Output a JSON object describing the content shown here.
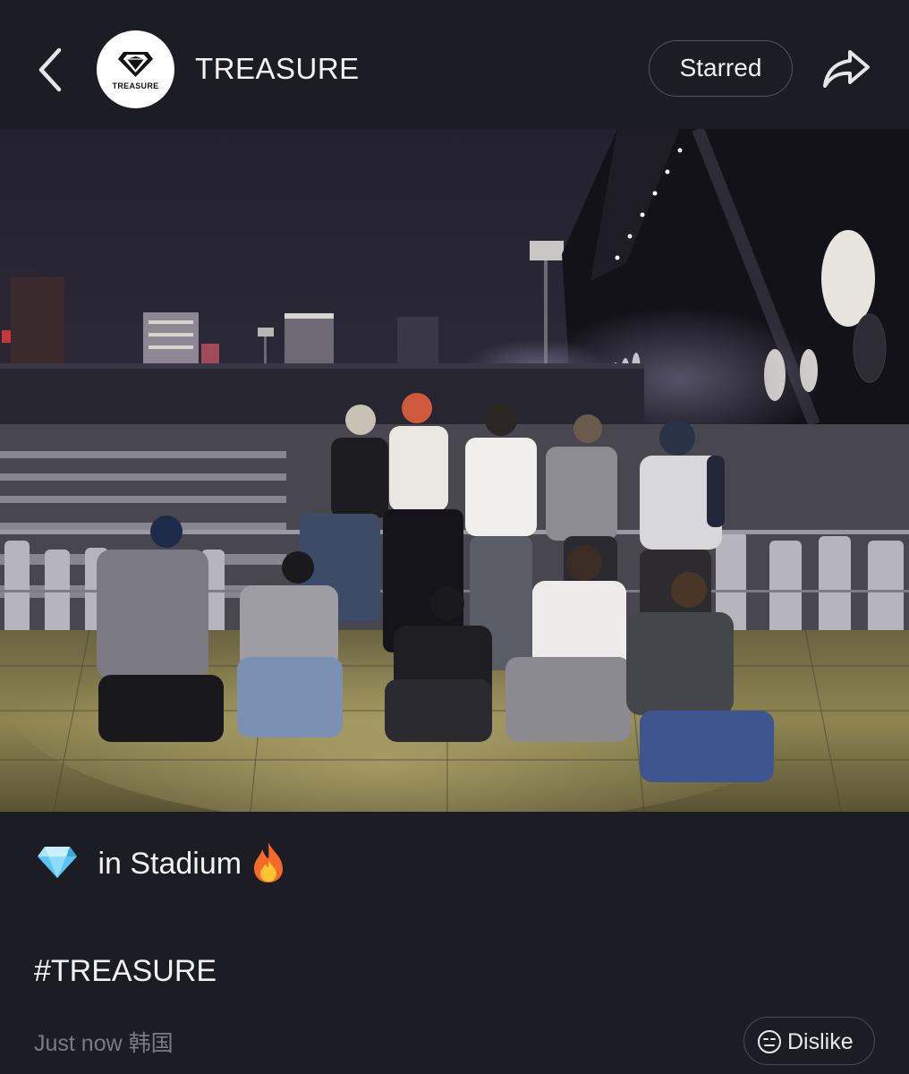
{
  "header": {
    "account_name": "TREASURE",
    "avatar_logo_text": "TREASURE",
    "starred_label": "Starred",
    "back_icon": "chevron-left-icon",
    "share_icon": "share-arrow-icon"
  },
  "post": {
    "caption_text": "in Stadium",
    "caption_icons": [
      "diamond-icon",
      "fire-icon"
    ],
    "hashtag": "#TREASURE",
    "timestamp": "Just now",
    "location": "韩国",
    "dislike_label": "Dislike",
    "dislike_icon": "smiley-face-icon"
  },
  "colors": {
    "background": "#1c1c24",
    "text_primary": "#f2f2f4",
    "text_muted": "#7b7b84",
    "button_border": "#55555e"
  }
}
